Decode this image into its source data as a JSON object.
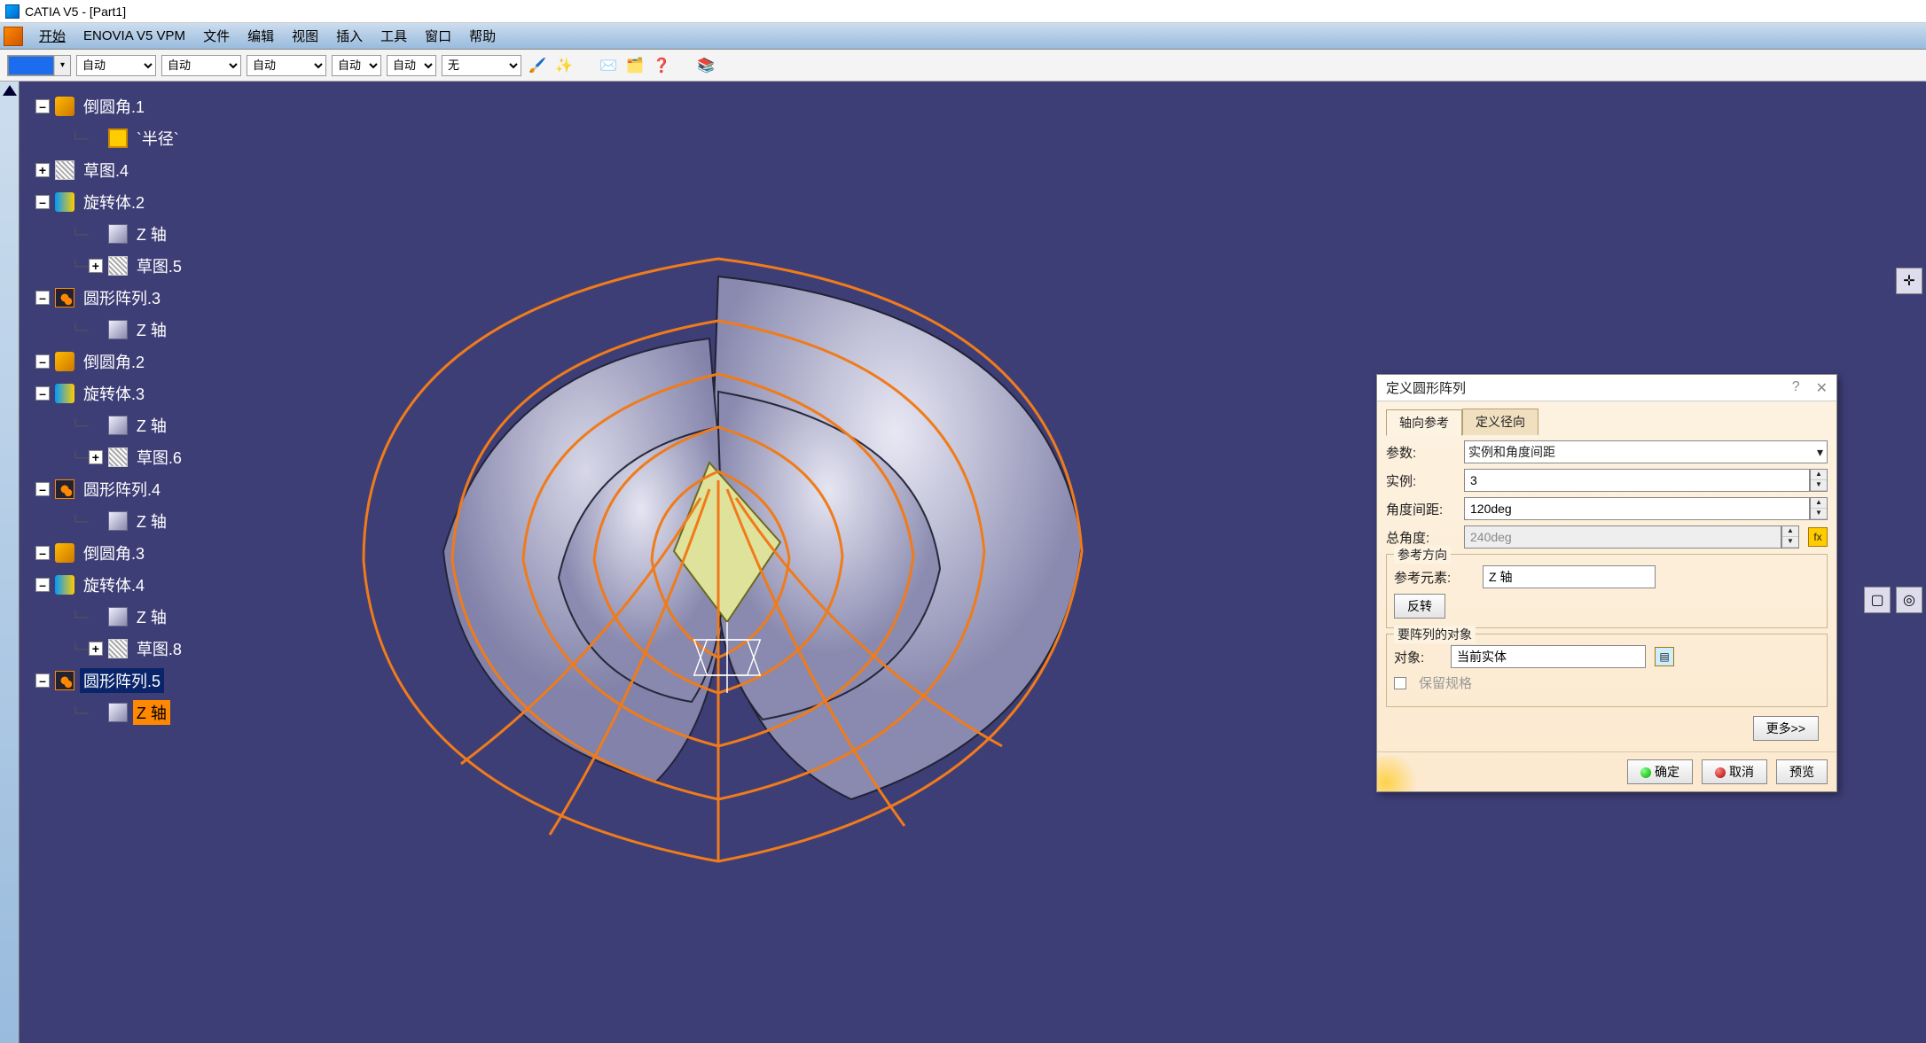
{
  "title": "CATIA V5 - [Part1]",
  "menubar": [
    "开始",
    "ENOVIA V5 VPM",
    "文件",
    "编辑",
    "视图",
    "插入",
    "工具",
    "窗口",
    "帮助"
  ],
  "toolbar": {
    "combos": [
      "自动",
      "自动",
      "自动",
      "自动",
      "自动",
      "无"
    ]
  },
  "tree": [
    {
      "expand": "-",
      "indent": 0,
      "icon": "ic-fillet",
      "label": "倒圆角.1"
    },
    {
      "expand": "",
      "indent": 1,
      "icon": "ic-param",
      "label": "`半径`"
    },
    {
      "expand": "+",
      "indent": 0,
      "icon": "ic-sketch",
      "label": "草图.4"
    },
    {
      "expand": "-",
      "indent": 0,
      "icon": "ic-shaft",
      "label": "旋转体.2"
    },
    {
      "expand": "",
      "indent": 1,
      "icon": "ic-axis",
      "label": "Z 轴"
    },
    {
      "expand": "+",
      "indent": 1,
      "icon": "ic-sketch",
      "label": "草图.5"
    },
    {
      "expand": "-",
      "indent": 0,
      "icon": "ic-pattern",
      "label": "圆形阵列.3"
    },
    {
      "expand": "",
      "indent": 1,
      "icon": "ic-axis",
      "label": "Z 轴"
    },
    {
      "expand": "-",
      "indent": 0,
      "icon": "ic-fillet",
      "label": "倒圆角.2"
    },
    {
      "expand": "-",
      "indent": 0,
      "icon": "ic-shaft",
      "label": "旋转体.3"
    },
    {
      "expand": "",
      "indent": 1,
      "icon": "ic-axis",
      "label": "Z 轴"
    },
    {
      "expand": "+",
      "indent": 1,
      "icon": "ic-sketch",
      "label": "草图.6"
    },
    {
      "expand": "-",
      "indent": 0,
      "icon": "ic-pattern",
      "label": "圆形阵列.4"
    },
    {
      "expand": "",
      "indent": 1,
      "icon": "ic-axis",
      "label": "Z 轴"
    },
    {
      "expand": "-",
      "indent": 0,
      "icon": "ic-fillet",
      "label": "倒圆角.3"
    },
    {
      "expand": "-",
      "indent": 0,
      "icon": "ic-shaft",
      "label": "旋转体.4"
    },
    {
      "expand": "",
      "indent": 1,
      "icon": "ic-axis",
      "label": "Z 轴"
    },
    {
      "expand": "+",
      "indent": 1,
      "icon": "ic-sketch",
      "label": "草图.8"
    },
    {
      "expand": "-",
      "indent": 0,
      "icon": "ic-pattern",
      "label": "圆形阵列.5",
      "sel": "sel"
    },
    {
      "expand": "",
      "indent": 1,
      "icon": "ic-axis",
      "label": "Z 轴",
      "sel": "sel2"
    }
  ],
  "dialog": {
    "title": "定义圆形阵列",
    "tabs": [
      "轴向参考",
      "定义径向"
    ],
    "params_label": "参数:",
    "params_value": "实例和角度间距",
    "instances_label": "实例:",
    "instances_value": "3",
    "angle_spacing_label": "角度间距:",
    "angle_spacing_value": "120deg",
    "total_angle_label": "总角度:",
    "total_angle_value": "240deg",
    "ref_dir_group": "参考方向",
    "ref_elem_label": "参考元素:",
    "ref_elem_value": "Z 轴",
    "reverse": "反转",
    "obj_group": "要阵列的对象",
    "obj_label": "对象:",
    "obj_value": "当前实体",
    "keep_spec": "保留规格",
    "more": "更多>>",
    "ok": "确定",
    "cancel": "取消",
    "preview": "预览"
  }
}
